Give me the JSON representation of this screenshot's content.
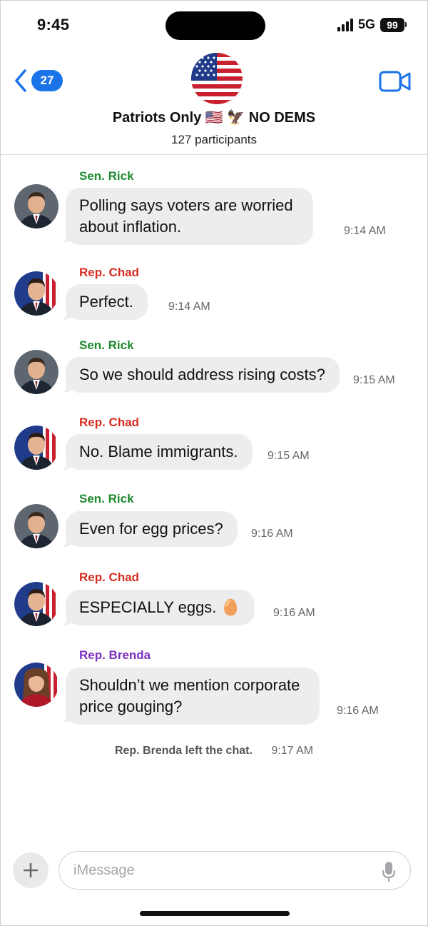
{
  "status": {
    "time": "9:45",
    "network": "5G",
    "battery": "99"
  },
  "header": {
    "back_count": "27",
    "title": "Patriots Only 🇺🇸 🦅 NO DEMS",
    "participants": "127 participants"
  },
  "messages": [
    {
      "sender": "Sen. Rick",
      "sender_color": "#1e8a2e",
      "text_lines": [
        "Polling says voters are worried",
        "about inflation."
      ],
      "time": "9:14 AM"
    },
    {
      "sender": "Rep. Chad",
      "sender_color": "#d62d20",
      "text_lines": [
        "Perfect."
      ],
      "time": "9:14 AM"
    },
    {
      "sender": "Sen. Rick",
      "sender_color": "#1e8a2e",
      "text_lines": [
        "So we should address rising costs?"
      ],
      "time": "9:15 AM"
    },
    {
      "sender": "Rep. Chad",
      "sender_color": "#d62d20",
      "text_lines": [
        "No. Blame immigrants."
      ],
      "time": "9:15 AM"
    },
    {
      "sender": "Sen. Rick",
      "sender_color": "#1e8a2e",
      "text_lines": [
        "Even for egg prices?"
      ],
      "time": "9:16 AM"
    },
    {
      "sender": "Rep. Chad",
      "sender_color": "#d62d20",
      "text_lines": [
        "ESPECIALLY eggs. 🥚"
      ],
      "time": "9:16 AM"
    },
    {
      "sender": "Rep. Brenda",
      "sender_color": "#7b2fbf",
      "text_lines": [
        "Shouldn’t we mention corporate",
        "price gouging?"
      ],
      "time": "9:16 AM"
    }
  ],
  "system_event": {
    "name": "Rep. Brenda",
    "text": "left the chat.",
    "time": "9:17 AM"
  },
  "composer": {
    "placeholder": "iMessage"
  },
  "colors": {
    "accent": "#1a73e8",
    "bubble": "#ededf0"
  }
}
